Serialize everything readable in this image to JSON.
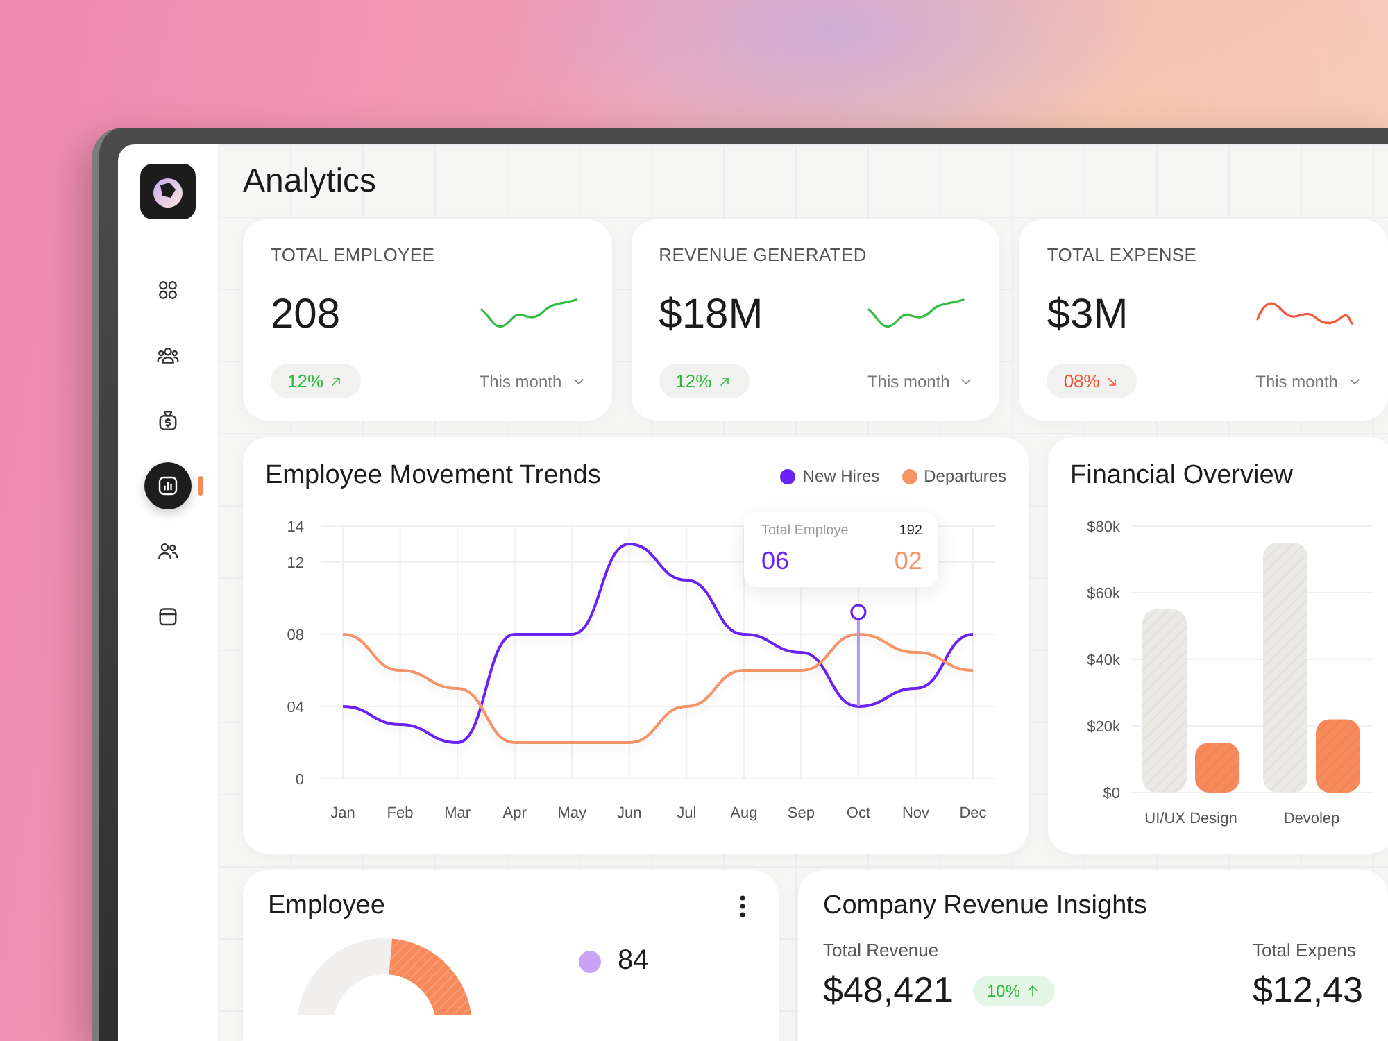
{
  "sidebar": {
    "items": [
      {
        "selected": false
      },
      {
        "selected": false
      },
      {
        "selected": false
      },
      {
        "selected": true
      },
      {
        "selected": false
      },
      {
        "selected": false
      }
    ]
  },
  "header": {
    "title": "Analytics"
  },
  "stats": [
    {
      "label": "TOTAL EMPLOYEE",
      "value": "208",
      "change": "12%",
      "kind": "up",
      "period": "This month"
    },
    {
      "label": "REVENUE GENERATED",
      "value": "$18M",
      "change": "12%",
      "kind": "up",
      "period": "This month"
    },
    {
      "label": "TOTAL EXPENSE",
      "value": "$3M",
      "change": "08%",
      "kind": "down",
      "period": "This month"
    }
  ],
  "movement": {
    "chart_data": {
      "type": "line",
      "title": "Employee Movement Trends",
      "categories": [
        "Jan",
        "Feb",
        "Mar",
        "Apr",
        "May",
        "Jun",
        "Jul",
        "Aug",
        "Sep",
        "Oct",
        "Nov",
        "Dec"
      ],
      "ylim": [
        0,
        14
      ],
      "yticks": [
        {
          "value": 0,
          "label": "0"
        },
        {
          "value": 4,
          "label": "04"
        },
        {
          "value": 8,
          "label": "08"
        },
        {
          "value": 12,
          "label": "12"
        },
        {
          "value": 14,
          "label": "14"
        }
      ],
      "grid": true,
      "legend": "top-right",
      "series": [
        {
          "name": "New Hires",
          "color": "#6b22f2",
          "values": [
            4,
            3,
            2,
            8,
            8,
            13,
            11,
            8,
            7,
            4,
            5,
            8
          ]
        },
        {
          "name": "Departures",
          "color": "#f59466",
          "values": [
            8,
            6,
            5,
            2,
            2,
            2,
            4,
            6,
            6,
            8,
            7,
            6
          ]
        }
      ]
    },
    "tooltip": {
      "label": "Total Employe",
      "total": "192",
      "readings": [
        "06",
        "02"
      ]
    }
  },
  "financial": {
    "chart_data": {
      "type": "bar",
      "title": "Financial Overview",
      "categories": [
        "UI/UX Design",
        "Devolep"
      ],
      "ylim": [
        0,
        80000
      ],
      "yticks": [
        {
          "value": 0,
          "label": "$0"
        },
        {
          "value": 20000,
          "label": "$20k"
        },
        {
          "value": 40000,
          "label": "$40k"
        },
        {
          "value": 60000,
          "label": "$60k"
        },
        {
          "value": 80000,
          "label": "$80k"
        }
      ],
      "grid": true,
      "series": [
        {
          "color": "#ebe9e6",
          "values": [
            55000,
            75000
          ]
        },
        {
          "color": "#f7895a",
          "values": [
            15000,
            22000
          ]
        }
      ]
    }
  },
  "employee": {
    "title": "Employee",
    "legend": [
      {
        "value": "84",
        "color": "#c9a3f6"
      }
    ]
  },
  "revenue": {
    "title": "Company Revenue Insights",
    "metrics": [
      {
        "label": "Total Revenue",
        "value": "$48,421",
        "change": "10%",
        "kind": "up"
      },
      {
        "label": "Total Expens",
        "value": "$12,43",
        "kind": "plain"
      }
    ]
  }
}
